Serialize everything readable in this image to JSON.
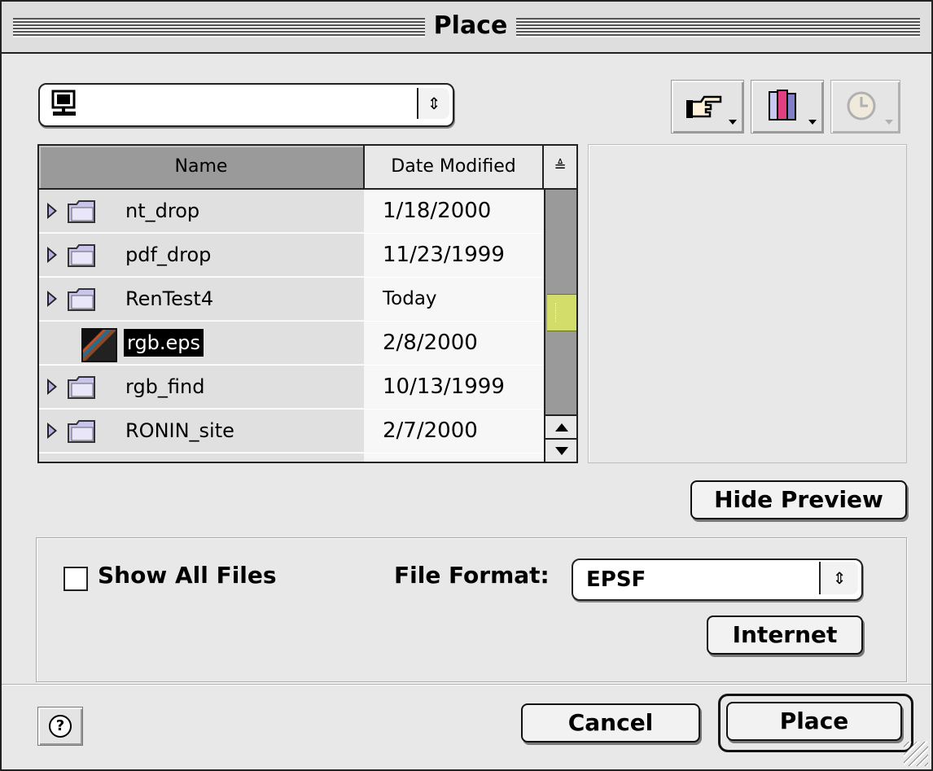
{
  "window": {
    "title": "Place"
  },
  "toolbar": {
    "shortcuts_icon": "pointing-hand-icon",
    "favorites_icon": "books-icon",
    "recent_icon": "clock-icon"
  },
  "location": {
    "icon": "desktop-computer-icon",
    "arrow": "⇕"
  },
  "file_list": {
    "columns": {
      "name": "Name",
      "date": "Date Modified",
      "sort": "≜"
    },
    "rows": [
      {
        "name": "nt_drop",
        "date": "1/18/2000",
        "kind": "folder"
      },
      {
        "name": "pdf_drop",
        "date": "11/23/1999",
        "kind": "folder"
      },
      {
        "name": "RenTest4",
        "date": "Today",
        "kind": "folder"
      },
      {
        "name": "rgb.eps",
        "date": "2/8/2000",
        "kind": "eps",
        "selected": true
      },
      {
        "name": "rgb_find",
        "date": "10/13/1999",
        "kind": "folder"
      },
      {
        "name": "RONIN_site",
        "date": "2/7/2000",
        "kind": "folder"
      }
    ],
    "scroll_position": 0.55
  },
  "buttons": {
    "hide_preview": "Hide Preview",
    "internet": "Internet",
    "cancel": "Cancel",
    "place": "Place",
    "help": "?"
  },
  "options": {
    "show_all_files": "Show All Files",
    "show_all_checked": false,
    "file_format_label": "File Format:",
    "file_format_value": "EPSF",
    "file_format_arrow": "⇕"
  },
  "colors": {
    "selection": "#000000",
    "scroll_thumb": "#d2dd6a",
    "window_bg": "#e8e8e8"
  }
}
